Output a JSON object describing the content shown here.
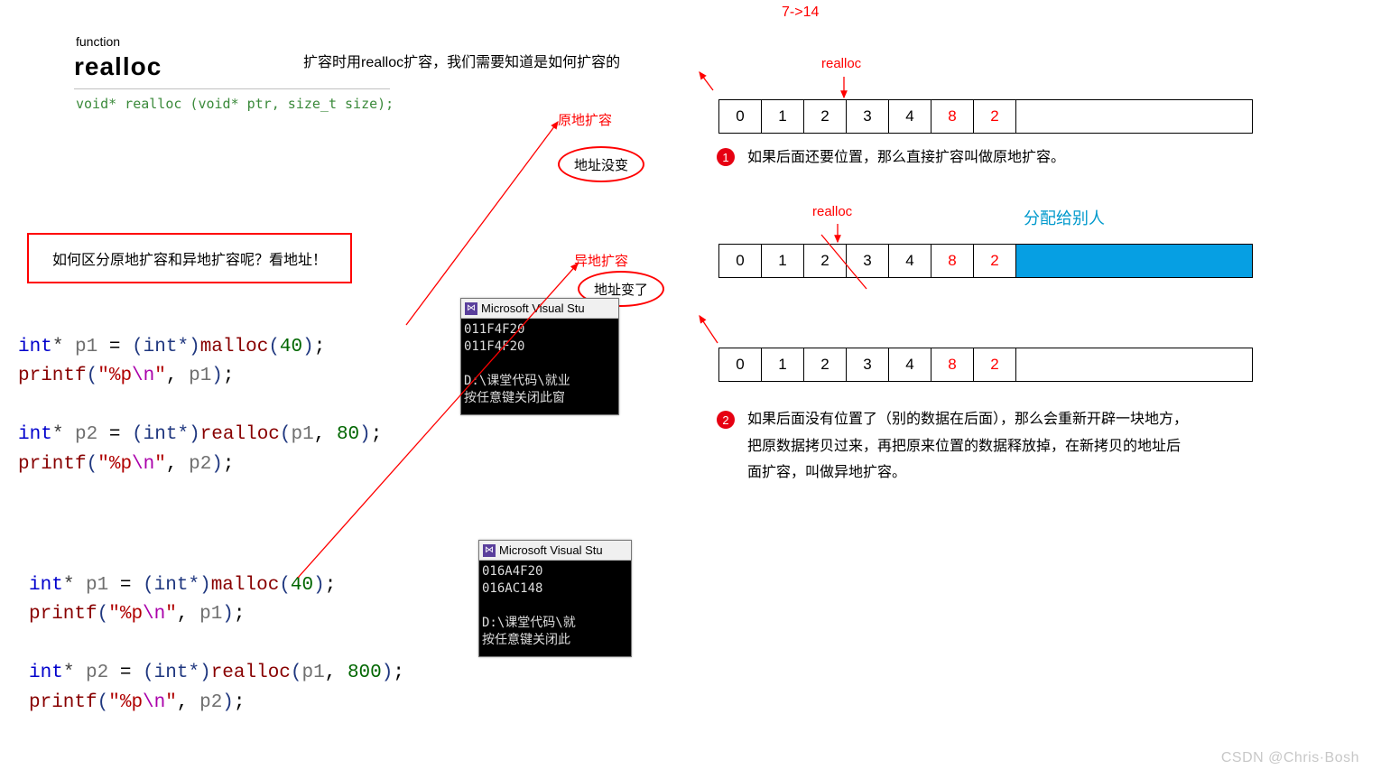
{
  "header": {
    "annotation": "7->14",
    "function_label": "function",
    "function_name": "realloc",
    "signature": "void* realloc (void* ptr, size_t size);",
    "intro_text": "扩容时用realloc扩容，我们需要知道是如何扩容的"
  },
  "oval_labels": {
    "inplace_title": "原地扩容",
    "inplace_note": "地址没变",
    "move_title": "异地扩容",
    "move_note": "地址变了"
  },
  "note_box": "如何区分原地扩容和异地扩容呢？看地址！",
  "code_blocks": {
    "block1_line1_parts": [
      "int",
      "*",
      " p1 ",
      "=",
      "(int*)",
      "malloc",
      "(",
      "40",
      ")",
      ";"
    ],
    "block1_line2_parts": [
      "printf",
      "(",
      "\"%p",
      "\\n",
      "\"",
      ",",
      " p1",
      ")",
      ";"
    ],
    "block1_line3_parts": [
      "int",
      "*",
      " p2 ",
      "=",
      "(int*)",
      "realloc",
      "(",
      "p1",
      ",",
      " 80",
      ")",
      ";"
    ],
    "block1_line4_parts": [
      "printf",
      "(",
      "\"%p",
      "\\n",
      "\"",
      ",",
      " p2",
      ")",
      ";"
    ],
    "block2_line1_parts": [
      "int",
      "*",
      " p1 ",
      "=",
      "(int*)",
      "malloc",
      "(",
      "40",
      ")",
      ";"
    ],
    "block2_line2_parts": [
      "printf",
      "(",
      "\"%p",
      "\\n",
      "\"",
      ",",
      " p1",
      ")",
      ";"
    ],
    "block2_line3_parts": [
      "int",
      "*",
      " p2 ",
      "=",
      "(int*)",
      "realloc",
      "(",
      "p1",
      ",",
      " 800",
      ")",
      ";"
    ],
    "block2_line4_parts": [
      "printf",
      "(",
      "\"%p",
      "\\n",
      "\"",
      ",",
      " p2",
      ")",
      ";"
    ]
  },
  "console": {
    "title": "Microsoft Visual Stu",
    "win1_lines": [
      "011F4F20",
      "011F4F20",
      "",
      "D:\\课堂代码\\就业",
      "按任意键关闭此窗"
    ],
    "win2_lines": [
      "016A4F20",
      "016AC148",
      "",
      "D:\\课堂代码\\就",
      "按任意键关闭此"
    ]
  },
  "diagrams": {
    "realloc_label": "realloc",
    "other_alloc_label": "分配给别人",
    "cells_row1": [
      "0",
      "1",
      "2",
      "3",
      "4",
      "8",
      "2"
    ],
    "cells_row2": [
      "0",
      "1",
      "2",
      "3",
      "4",
      "8",
      "2"
    ],
    "cells_row3": [
      "0",
      "1",
      "2",
      "3",
      "4",
      "8",
      "2"
    ]
  },
  "bullets": {
    "b1": "1",
    "b2": "2",
    "text1": "如果后面还要位置，那么直接扩容叫做原地扩容。",
    "text2": "如果后面没有位置了（别的数据在后面），那么会重新开辟一块地方，把原数据拷贝过来，再把原来位置的数据释放掉，在新拷贝的地址后面扩容，叫做异地扩容。"
  },
  "watermark": "CSDN @Chris·Bosh"
}
